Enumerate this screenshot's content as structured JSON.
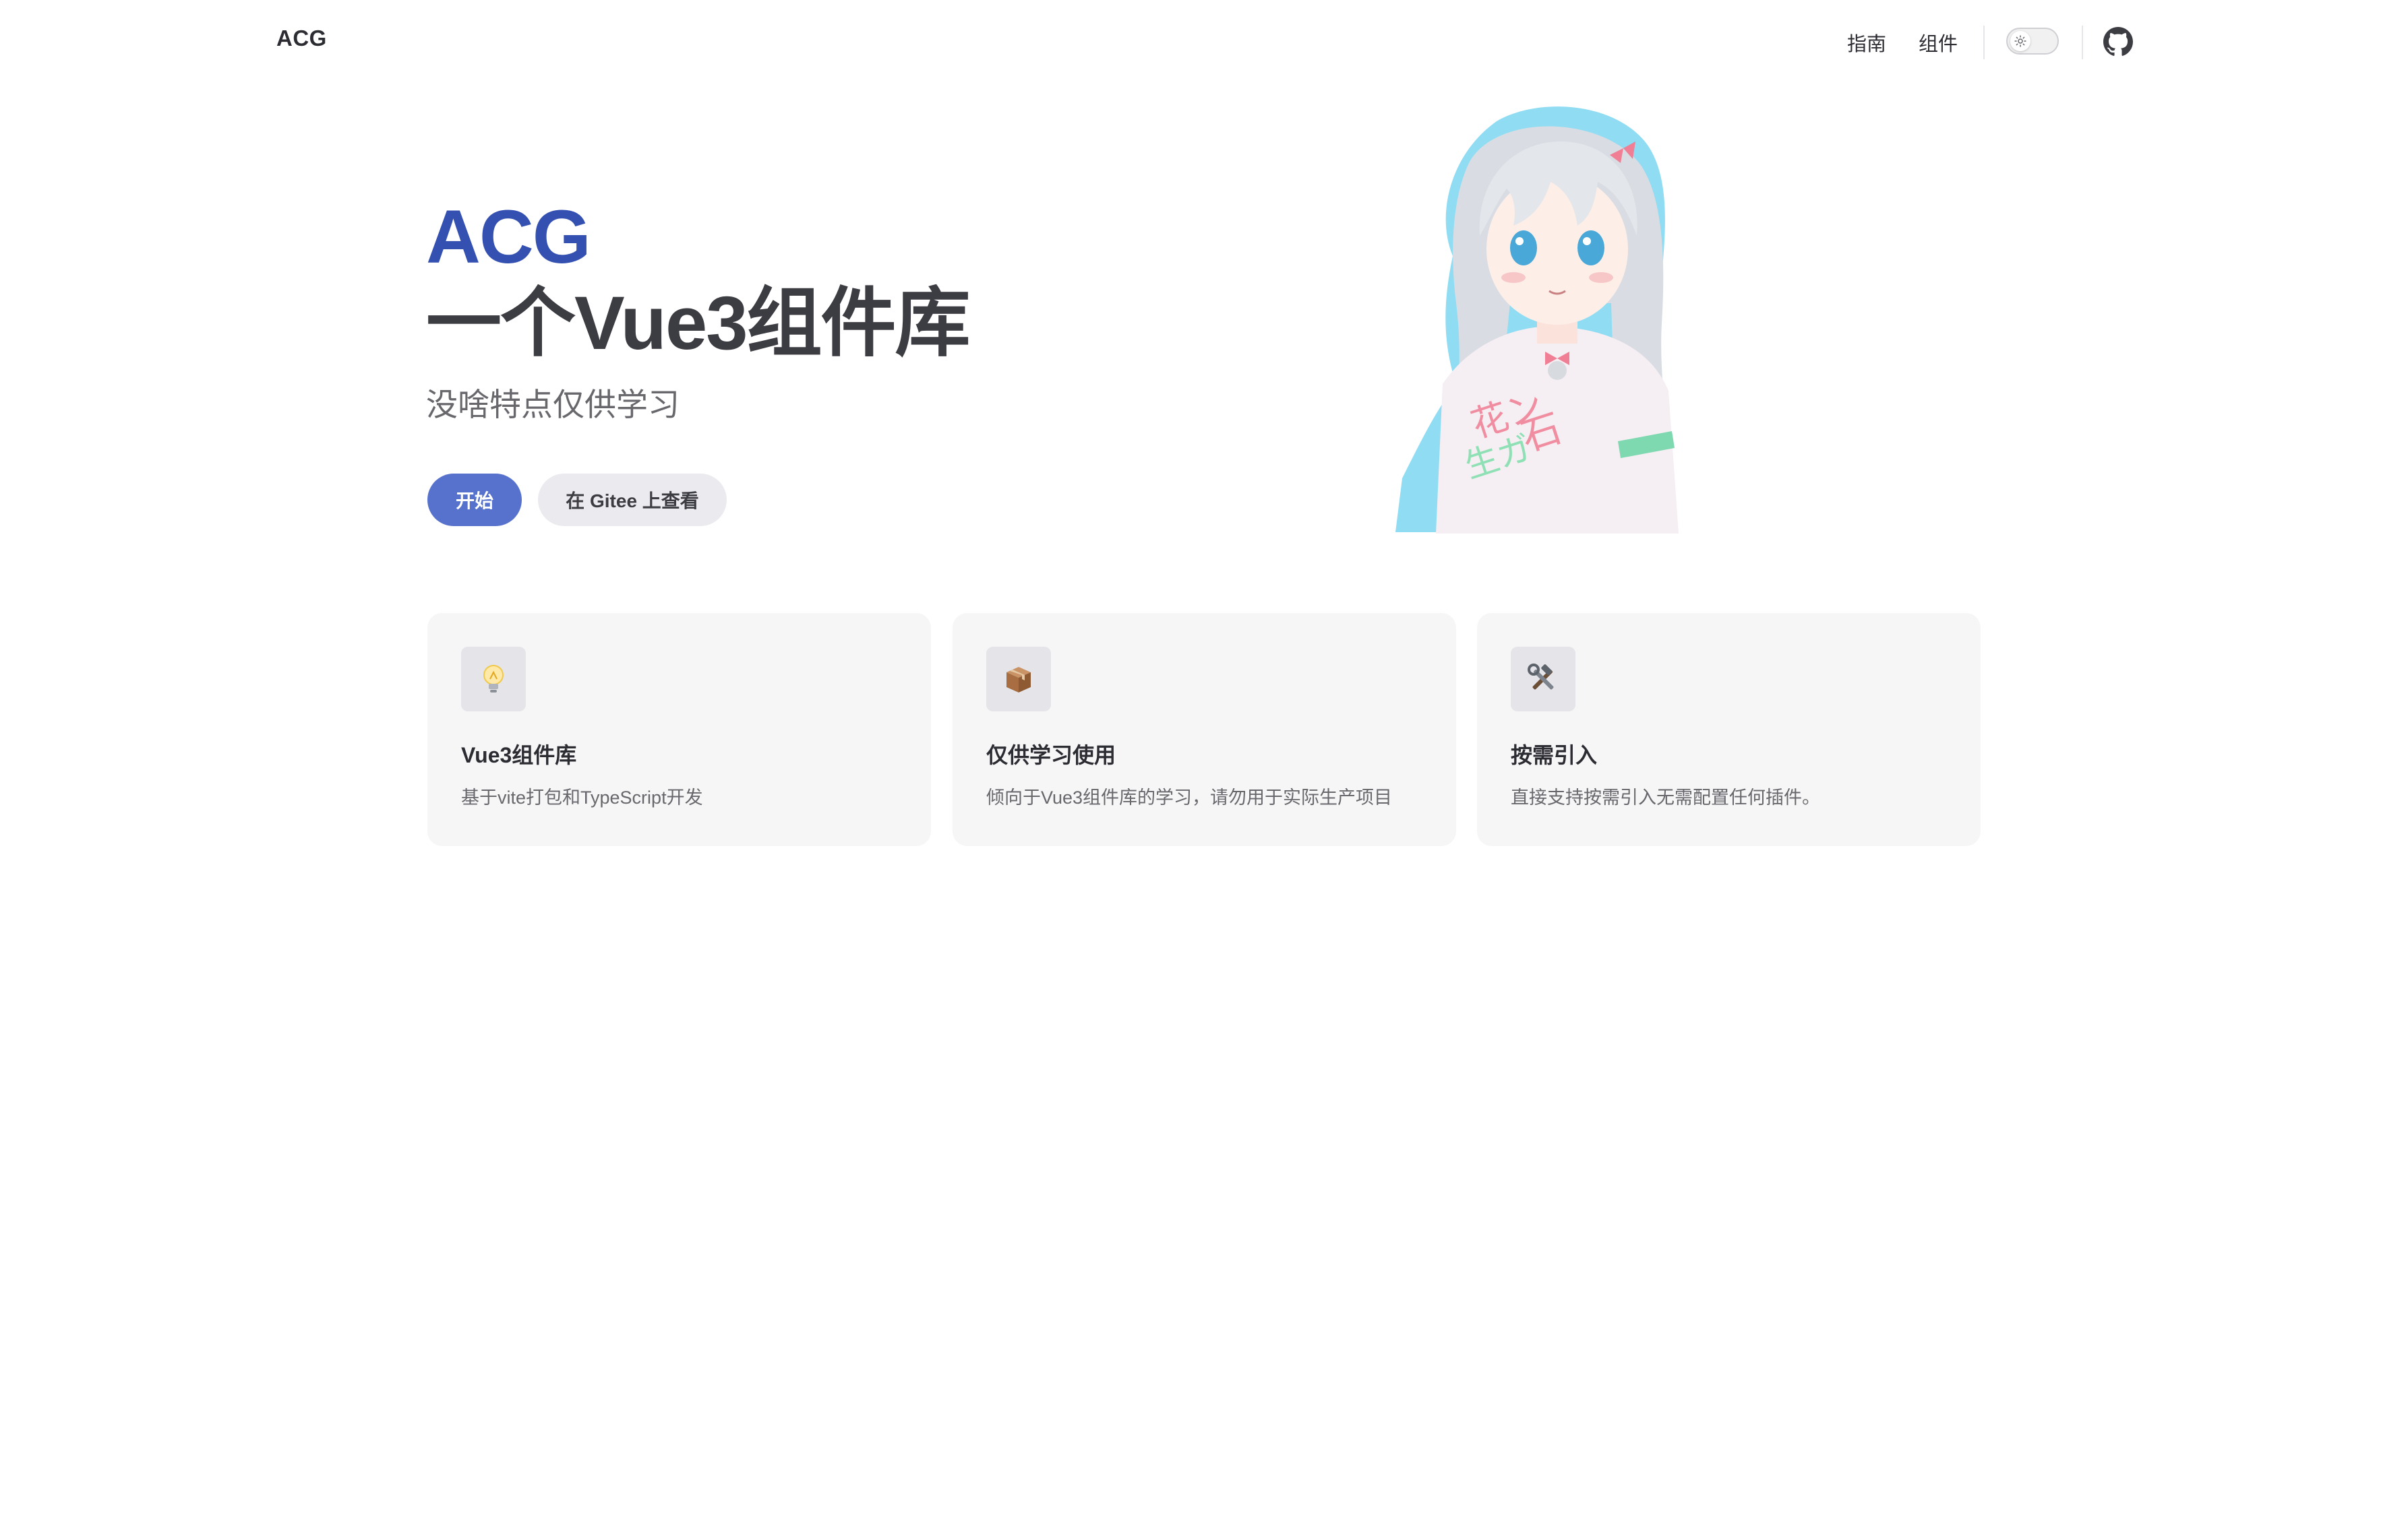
{
  "nav": {
    "brand": "ACG",
    "links": [
      "指南",
      "组件"
    ],
    "theme_toggle_icon": "sun-icon",
    "social_icon": "github-icon"
  },
  "hero": {
    "name": "ACG",
    "text": "一个Vue3组件库",
    "tagline": "没啥特点仅供学习",
    "actions": {
      "primary_label": "开始",
      "secondary_label": "在 Gitee 上查看"
    },
    "image": "anime-character-illustration"
  },
  "features": [
    {
      "icon": "lightbulb-icon",
      "title": "Vue3组件库",
      "details": "基于vite打包和TypeScript开发"
    },
    {
      "icon": "package-icon",
      "title": "仅供学习使用",
      "details": "倾向于Vue3组件库的学习，请勿用于实际生产项目"
    },
    {
      "icon": "tools-icon",
      "title": "按需引入",
      "details": "直接支持按需引入无需配置任何插件。"
    }
  ],
  "colors": {
    "brand": "#3451b2",
    "button": "#5672cd",
    "text": "#3c3c43",
    "card": "#f6f6f7"
  }
}
